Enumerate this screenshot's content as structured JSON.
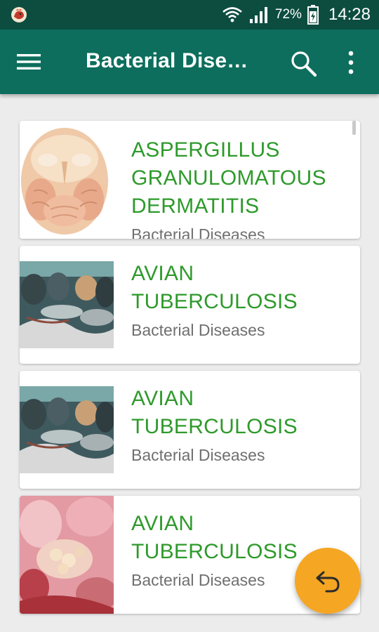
{
  "status_bar": {
    "battery_percent": "72%",
    "time": "14:28"
  },
  "app_bar": {
    "title": "Bacterial Dise…"
  },
  "items": [
    {
      "title": "ASPERGILLUS GRANULOMATOUS DERMATITIS",
      "subtitle": "Bacterial Diseases"
    },
    {
      "title": "AVIAN TUBERCULOSIS",
      "subtitle": "Bacterial Diseases"
    },
    {
      "title": "AVIAN TUBERCULOSIS",
      "subtitle": "Bacterial Diseases"
    },
    {
      "title": "AVIAN TUBERCULOSIS",
      "subtitle": "Bacterial Diseases"
    }
  ],
  "colors": {
    "status_bar": "#0c4d40",
    "app_bar": "#0d6e5d",
    "title_text": "#2e9a2b",
    "subtitle_text": "#6f6f6f",
    "fab": "#f5a623"
  },
  "icons": {
    "app": "chicken-app-icon",
    "wifi": "wifi-icon",
    "signal": "signal-icon",
    "battery": "battery-icon",
    "menu": "hamburger-menu-icon",
    "search": "search-icon",
    "overflow": "more-vert-icon",
    "fab": "undo-arrow-icon"
  }
}
